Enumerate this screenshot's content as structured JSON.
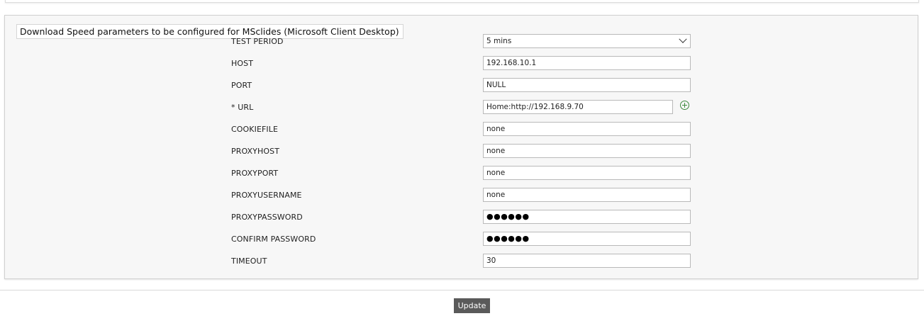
{
  "legend": "Download Speed parameters to be configured for MSclides (Microsoft Client Desktop)",
  "fields": {
    "test_period": {
      "label": "TEST PERIOD",
      "value": "5 mins"
    },
    "host": {
      "label": "HOST",
      "value": "192.168.10.1"
    },
    "port": {
      "label": "PORT",
      "value": "NULL"
    },
    "url": {
      "label": "* URL",
      "value": "Home:http://192.168.9.70"
    },
    "cookiefile": {
      "label": "COOKIEFILE",
      "value": "none"
    },
    "proxyhost": {
      "label": "PROXYHOST",
      "value": "none"
    },
    "proxyport": {
      "label": "PROXYPORT",
      "value": "none"
    },
    "proxyusername": {
      "label": "PROXYUSERNAME",
      "value": "none"
    },
    "proxypassword": {
      "label": "PROXYPASSWORD",
      "value": "●●●●●●"
    },
    "confirm_password": {
      "label": "CONFIRM PASSWORD",
      "value": "●●●●●●"
    },
    "timeout": {
      "label": "TIMEOUT",
      "value": "30"
    }
  },
  "icons": {
    "add_url": "add-circle-icon",
    "dropdown": "chevron-down-icon"
  },
  "colors": {
    "button_bg": "#5a5a5a",
    "add_icon": "#3c8a3c"
  },
  "actions": {
    "update_label": "Update"
  }
}
